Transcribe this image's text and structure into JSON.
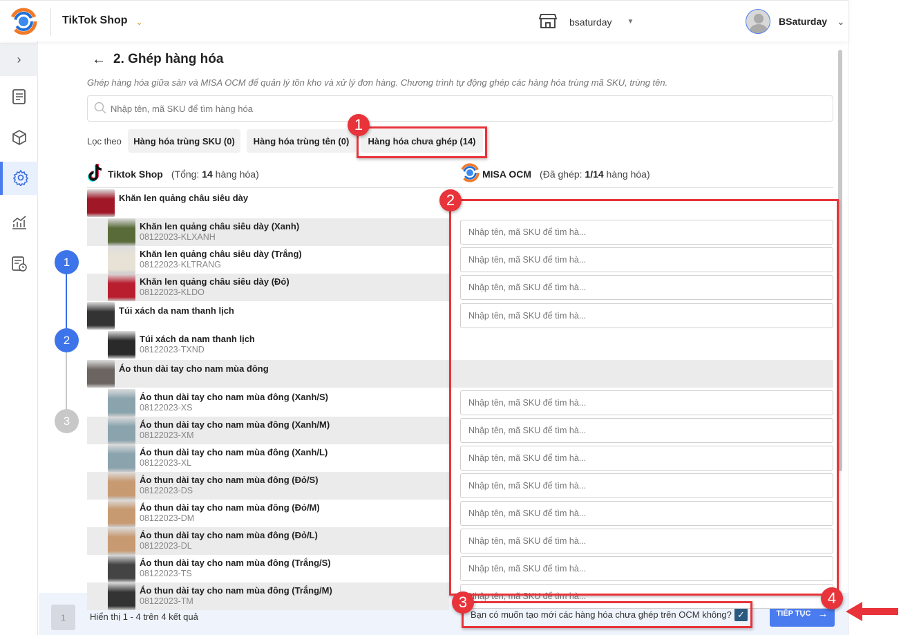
{
  "header": {
    "shop_title": "TikTok Shop",
    "store_name": "bsaturday",
    "user_name": "BSaturday"
  },
  "page": {
    "title": "2. Ghép hàng hóa",
    "description": "Ghép hàng hóa giữa sàn và MISA OCM để quản lý tồn kho và xử lý đơn hàng. Chương trình tự động ghép các hàng hóa trùng mã SKU, trùng tên.",
    "search_placeholder": "Nhập tên, mã SKU để tìm hàng hóa"
  },
  "filter": {
    "label": "Lọc theo",
    "chips": [
      "Hàng hóa trùng SKU (0)",
      "Hàng hóa trùng tên (0)",
      "Hàng hóa chưa ghép (14)"
    ]
  },
  "columns": {
    "left_title": "Tiktok Shop",
    "left_prefix": "(Tổng: ",
    "left_count": "14",
    "left_suffix": " hàng hóa)",
    "right_title": "MISA OCM",
    "right_prefix": "(Đã ghép: ",
    "right_count": "1/14",
    "right_suffix": " hàng hóa)"
  },
  "input_placeholder": "Nhập tên, mã SKU để tìm hà...",
  "products": [
    {
      "name": "Khăn len quảng châu siêu dày",
      "parent": true,
      "input": false,
      "color": "#a01828"
    },
    {
      "name": "Khăn len quảng châu siêu dày (Xanh)",
      "sku": "08122023-KLXANH",
      "input": true,
      "color": "#5a6b3a"
    },
    {
      "name": "Khăn len quảng châu siêu dày (Trắng)",
      "sku": "08122023-KLTRANG",
      "input": true,
      "color": "#e8e2d6"
    },
    {
      "name": "Khăn len quảng châu siêu dày (Đỏ)",
      "sku": "08122023-KLDO",
      "input": true,
      "color": "#b81e2e"
    },
    {
      "name": "Túi xách da nam thanh lịch",
      "parent": true,
      "input": true,
      "color": "#333"
    },
    {
      "name": "Túi xách da nam thanh lịch",
      "sku": "08122023-TXND",
      "input": false,
      "color": "#2a2a2a"
    },
    {
      "name": "Áo thun dài tay cho nam mùa đông",
      "parent": true,
      "input": false,
      "color": "#6b6460"
    },
    {
      "name": "Áo thun dài tay cho nam mùa đông (Xanh/S)",
      "sku": "08122023-XS",
      "input": true,
      "color": "#8aa3ad"
    },
    {
      "name": "Áo thun dài tay cho nam mùa đông (Xanh/M)",
      "sku": "08122023-XM",
      "input": true,
      "color": "#8aa3ad"
    },
    {
      "name": "Áo thun dài tay cho nam mùa đông (Xanh/L)",
      "sku": "08122023-XL",
      "input": true,
      "color": "#8aa3ad"
    },
    {
      "name": "Áo thun dài tay cho nam mùa đông (Đỏ/S)",
      "sku": "08122023-DS",
      "input": true,
      "color": "#c79a72"
    },
    {
      "name": "Áo thun dài tay cho nam mùa đông (Đỏ/M)",
      "sku": "08122023-DM",
      "input": true,
      "color": "#c79a72"
    },
    {
      "name": "Áo thun dài tay cho nam mùa đông (Đỏ/L)",
      "sku": "08122023-DL",
      "input": true,
      "color": "#c79a72"
    },
    {
      "name": "Áo thun dài tay cho nam mùa đông (Trắng/S)",
      "sku": "08122023-TS",
      "input": true,
      "color": "#444"
    },
    {
      "name": "Áo thun dài tay cho nam mùa đông (Trắng/M)",
      "sku": "08122023-TM",
      "input": true,
      "color": "#333"
    }
  ],
  "steps": [
    "1",
    "2",
    "3"
  ],
  "footer": {
    "page": "1",
    "summary": "Hiển thị 1 - 4 trên 4 kết quả",
    "create_question": "Bạn có muốn tạo mới các hàng hóa chưa ghép trên OCM không?",
    "create_checked": true,
    "continue_label": "TIẾP TỤC"
  },
  "annotations": [
    "1",
    "2",
    "3",
    "4"
  ],
  "colors": {
    "primary": "#4a7cf0",
    "annotation": "#e8333a"
  }
}
